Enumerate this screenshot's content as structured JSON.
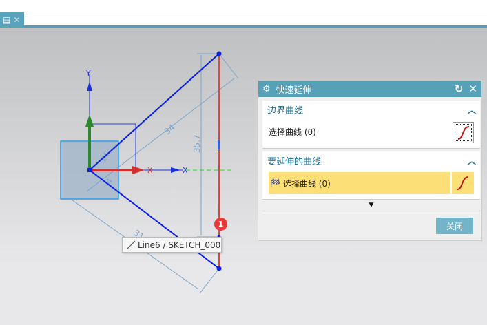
{
  "tab": {
    "close": "✕"
  },
  "sketch": {
    "dim_34": "34",
    "dim_35_7": "35.7",
    "dim_31_8": "31.8",
    "dim_24": "24",
    "dim_4": "4",
    "axis_y": "Y",
    "axis_x": "X"
  },
  "tooltip": "Line6 / SKETCH_000",
  "badge": "1",
  "dialog": {
    "title": "快速延伸",
    "groups": [
      {
        "title": "边界曲线",
        "select_label": "选择曲线 (0)"
      },
      {
        "title": "要延伸的曲线",
        "select_label": "选择曲线 (0)"
      }
    ],
    "close_label": "关闭"
  },
  "colors": {
    "accent": "#56a0b8",
    "highlight": "#fddf78"
  }
}
